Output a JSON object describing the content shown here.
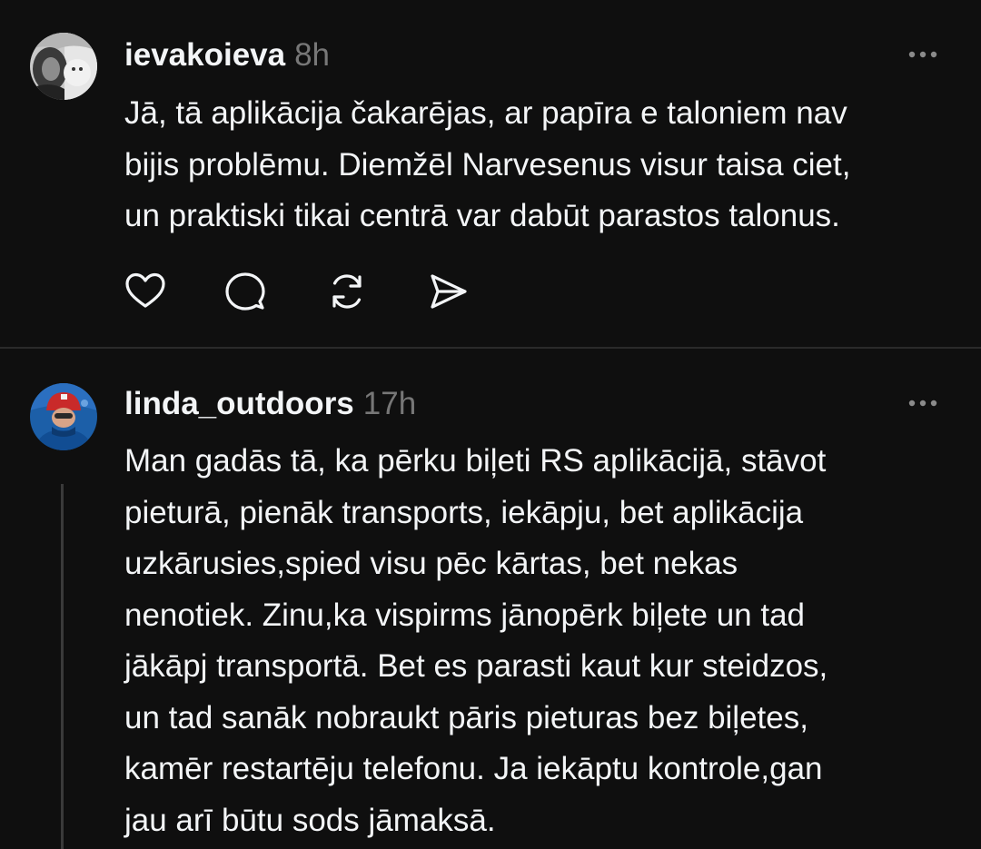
{
  "posts": [
    {
      "username": "ievakoieva",
      "time": "8h",
      "text": "Jā, tā aplikācija čakarējas, ar papīra e taloniem nav\nbijis problēmu. Diemžēl Narvesenus visur taisa ciet,\nun praktiski tikai centrā var dabūt parastos talonus."
    },
    {
      "username": "linda_outdoors",
      "time": "17h",
      "text": "Man gadās tā, ka pērku biļeti RS aplikācijā, stāvot\npieturā,  pienāk transports, iekāpju, bet aplikācija\nuzkārusies,spied visu pēc kārtas, bet nekas\nnenotiek. Zinu,ka vispirms jānopērk biļete un tad\njākāpj transportā. Bet es parasti kaut kur steidzos,\nun tad sanāk nobraukt pāris pieturas bez biļetes,\nkamēr restartēju telefonu. Ja iekāptu kontrole,gan\njau arī būtu sods jāmaksā."
    }
  ],
  "actions": [
    "heart-icon",
    "comment-icon",
    "repost-icon",
    "share-icon"
  ],
  "colors": {
    "background": "#0f0f0f",
    "text": "#f3f5f7",
    "muted": "#777777",
    "divider": "#2a2a2a",
    "icon": "#f3f5f7"
  }
}
